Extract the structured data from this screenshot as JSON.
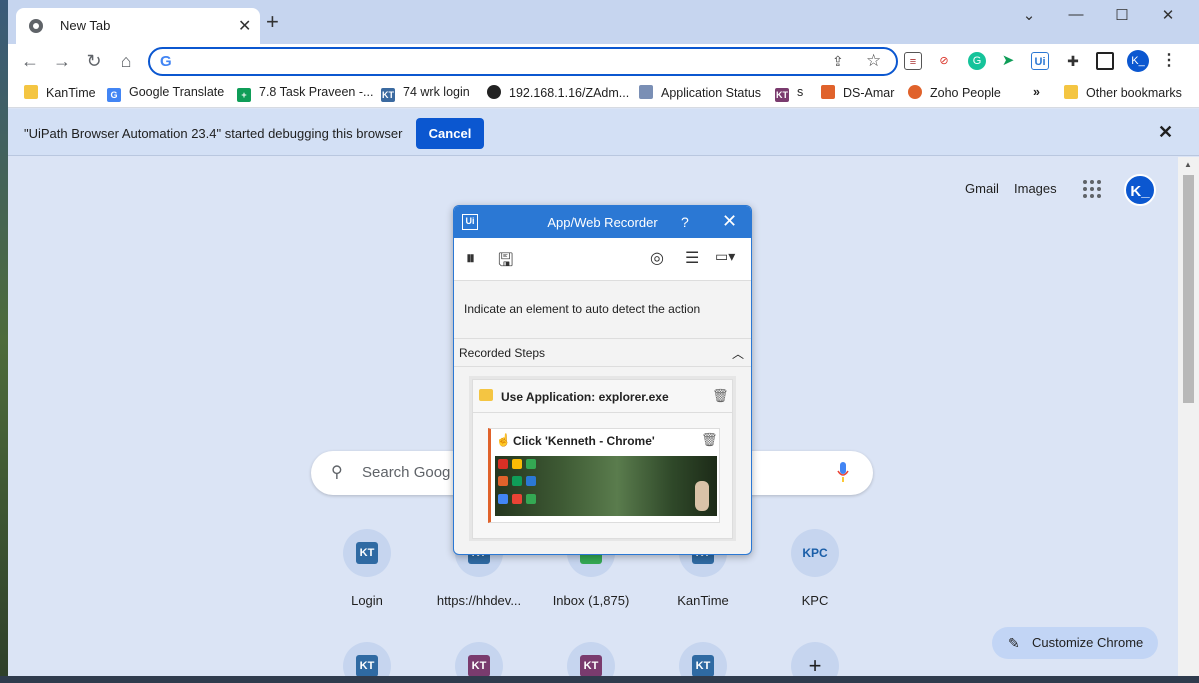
{
  "tab": {
    "title": "New Tab"
  },
  "window_controls": {
    "minimize": "⌄",
    "min": "—",
    "max": "☐",
    "close": "✕"
  },
  "toolbar": {
    "omnibox_value": "",
    "g": "G"
  },
  "bookmarks": [
    {
      "label": "KanTime",
      "color": "#f4c542"
    },
    {
      "label": "Google Translate",
      "color": "#4285f4"
    },
    {
      "label": "7.8 Task Praveen -...",
      "color": "#0f9d58"
    },
    {
      "label": "74 wrk login",
      "color": "#3b6aa0"
    },
    {
      "label": "192.168.1.16/ZAdm...",
      "color": "#222222"
    },
    {
      "label": "Application Status",
      "color": "#7a8fb5"
    },
    {
      "label": "s",
      "color": "#7a3b6e"
    },
    {
      "label": "DS-Amar",
      "color": "#e0622b"
    },
    {
      "label": "Zoho People",
      "color": "#e0622b"
    }
  ],
  "bookmarks_more": "»",
  "other_bookmarks": "Other bookmarks",
  "infobar": {
    "message": "\"UiPath Browser Automation 23.4\" started debugging this browser",
    "cancel": "Cancel"
  },
  "ntp": {
    "gmail": "Gmail",
    "images": "Images",
    "avatar": "K_",
    "search_placeholder": "Search Goog",
    "shortcuts": [
      {
        "label": "Login",
        "tile": "KT",
        "color": "#2f6aa3"
      },
      {
        "label": "https://hhdev...",
        "tile": "KT",
        "color": "#2f6aa3"
      },
      {
        "label": "Inbox (1,875)",
        "tile": "",
        "color": "#34a853"
      },
      {
        "label": "KanTime",
        "tile": "KT",
        "color": "#2f6aa3"
      },
      {
        "label": "KPC",
        "tile": "KPC",
        "color": "#1a5ea8"
      }
    ],
    "shortcuts_row2": [
      {
        "tile": "KT",
        "color": "#2f6aa3"
      },
      {
        "tile": "KT",
        "color": "#7a3b6e"
      },
      {
        "tile": "KT",
        "color": "#7a3b6e"
      },
      {
        "tile": "KT",
        "color": "#2f6aa3"
      },
      {
        "tile": "+",
        "color": "#1f1f1f"
      }
    ],
    "customize": "Customize Chrome"
  },
  "recorder": {
    "title": "App/Web Recorder",
    "help": "?",
    "hint": "Indicate an element to auto detect the action",
    "steps_header": "Recorded Steps",
    "step": "Use Application: explorer.exe",
    "substep": "Click 'Kenneth - Chrome'"
  }
}
